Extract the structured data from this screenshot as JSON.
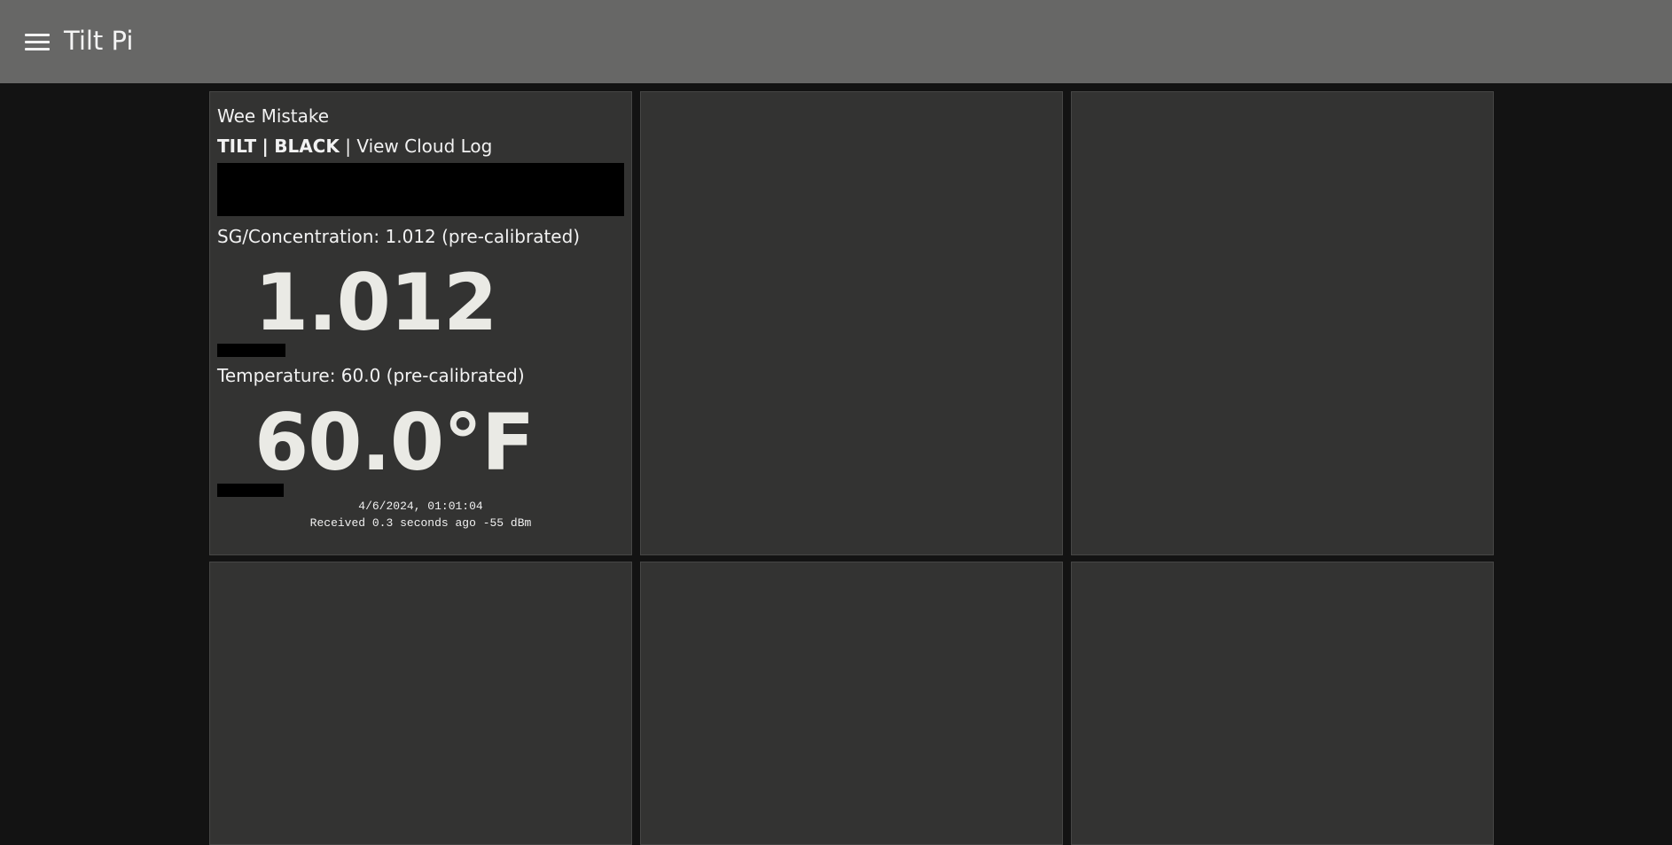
{
  "app": {
    "title": "Tilt Pi"
  },
  "icons": {
    "menu": "hamburger-menu-icon"
  },
  "colors": {
    "topbar": "#676766",
    "background": "#131313",
    "card": "#333332",
    "big_value": "#eaeae5"
  },
  "tilt_card": {
    "name": "Wee Mistake",
    "tilt_label": "TILT",
    "separator": "|",
    "color_label": "BLACK",
    "cloud_link": "View Cloud Log",
    "sg_label": "SG/Concentration: 1.012 (pre-calibrated)",
    "sg_value": "1.012",
    "temp_label": "Temperature: 60.0 (pre-calibrated)",
    "temp_value": "60.0°F",
    "timestamp": "4/6/2024, 01:01:04",
    "received": "Received 0.3 seconds ago -55 dBm"
  }
}
